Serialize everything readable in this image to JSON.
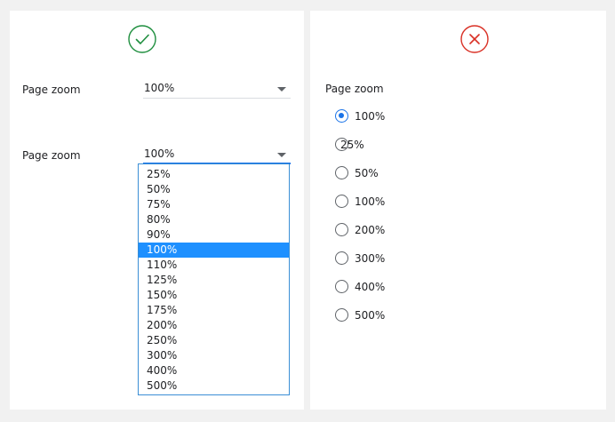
{
  "good_example": {
    "status_icon": "checkmark-circle-icon",
    "status_color": "#1e8e3e",
    "collapsed_select": {
      "label": "Page zoom",
      "value": "100%"
    },
    "open_select": {
      "label": "Page zoom",
      "value": "100%",
      "selected_index": 5,
      "options": [
        "25%",
        "50%",
        "75%",
        "80%",
        "90%",
        "100%",
        "110%",
        "125%",
        "150%",
        "175%",
        "200%",
        "250%",
        "300%",
        "400%",
        "500%"
      ]
    }
  },
  "bad_example": {
    "status_icon": "x-circle-icon",
    "status_color": "#d93025",
    "label": "Page zoom",
    "selected_index": 0,
    "radio_options": [
      "100%",
      "25%",
      "50%",
      "100%",
      "200%",
      "300%",
      "400%",
      "500%"
    ]
  },
  "colors": {
    "accent": "#1a73e8",
    "selected_option_bg": "#1e90ff"
  }
}
